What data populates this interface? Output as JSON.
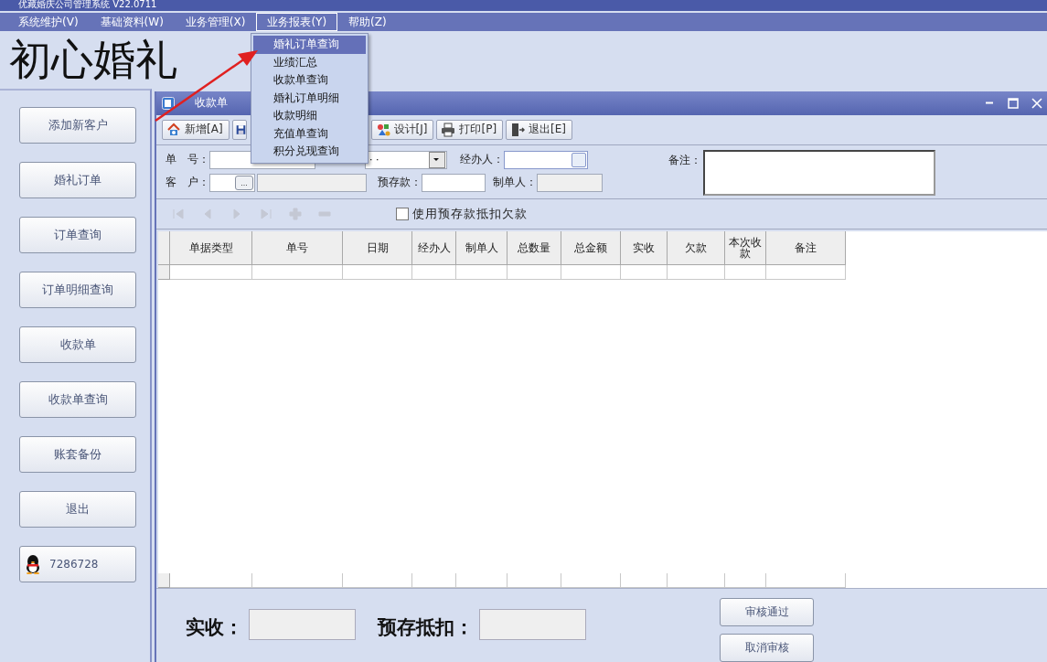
{
  "window": {
    "title": "优藏婚庆公司管理系统  V22.0711"
  },
  "menubar": [
    {
      "label": "系统维护(V)",
      "selected": false
    },
    {
      "label": "基础资料(W)",
      "selected": false
    },
    {
      "label": "业务管理(X)",
      "selected": false
    },
    {
      "label": "业务报表(Y)",
      "selected": true
    },
    {
      "label": "帮助(Z)",
      "selected": false
    }
  ],
  "dropdown": [
    {
      "label": "婚礼订单查询",
      "selected": true
    },
    {
      "label": "业绩汇总",
      "selected": false
    },
    {
      "label": "收款单查询",
      "selected": false
    },
    {
      "label": "婚礼订单明细",
      "selected": false
    },
    {
      "label": "收款明细",
      "selected": false
    },
    {
      "label": "充值单查询",
      "selected": false
    },
    {
      "label": "积分兑现查询",
      "selected": false
    }
  ],
  "brand": "初心婚礼",
  "sidebar": [
    {
      "label": "添加新客户",
      "kind": "plain"
    },
    {
      "label": "婚礼订单",
      "kind": "plain"
    },
    {
      "label": "订单查询",
      "kind": "plain"
    },
    {
      "label": "订单明细查询",
      "kind": "plain"
    },
    {
      "label": "收款单",
      "kind": "plain"
    },
    {
      "label": "收款单查询",
      "kind": "plain"
    },
    {
      "label": "账套备份",
      "kind": "plain"
    },
    {
      "label": "退出",
      "kind": "plain"
    },
    {
      "label": "7286728",
      "kind": "qq"
    }
  ],
  "child_window": {
    "title": "收款单"
  },
  "toolbar": [
    {
      "label": "新增[A]",
      "kind": "add"
    },
    {
      "kind": "save"
    },
    {
      "label": "设计[J]",
      "kind": "design"
    },
    {
      "label": "打印[P]",
      "kind": "print"
    },
    {
      "label": "退出[E]",
      "kind": "exit"
    }
  ],
  "form": {
    "browse_label": "...",
    "order_no_label": "单　号：",
    "date_value": "· ·",
    "handler_label": "经办人：",
    "customer_label": "客　户：",
    "deposit_label": "预存款：",
    "maker_label": "制单人：",
    "note_label": "备注："
  },
  "nav": [
    {
      "kind": "first",
      "disabled": true
    },
    {
      "kind": "prev",
      "disabled": true
    },
    {
      "kind": "next",
      "disabled": true
    },
    {
      "kind": "last",
      "disabled": true
    },
    {
      "kind": "add",
      "disabled": true
    },
    {
      "kind": "remove",
      "disabled": true
    }
  ],
  "use_deposit": {
    "label": "使用预存款抵扣欠款",
    "checked": false
  },
  "table": {
    "columns": [
      "单据类型",
      "单号",
      "日期",
      "经办人",
      "制单人",
      "总数量",
      "总金额",
      "实收",
      "欠款",
      "本次收款",
      "备注"
    ]
  },
  "summary": {
    "received_label": "实收：",
    "deposit_deduct_label": "预存抵扣："
  },
  "actions": [
    {
      "label": "审核通过"
    },
    {
      "label": "取消审核"
    }
  ]
}
